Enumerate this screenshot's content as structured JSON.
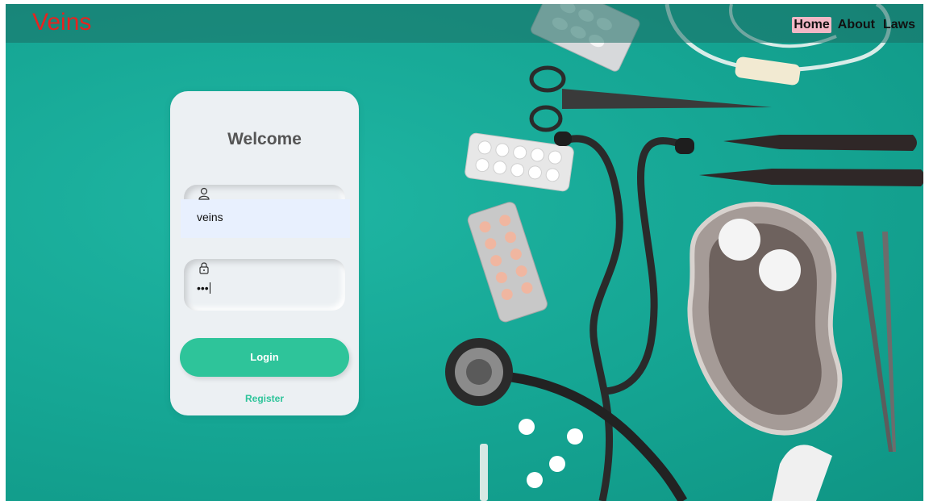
{
  "navbar": {
    "brand": "Veins",
    "links": [
      {
        "label": "Home",
        "active": true
      },
      {
        "label": "About",
        "active": false
      },
      {
        "label": "Laws",
        "active": false
      }
    ]
  },
  "login_card": {
    "heading": "Welcome",
    "username": {
      "icon": "user-icon",
      "value": "veins"
    },
    "password": {
      "icon": "lock-icon",
      "value": "•••"
    },
    "login_label": "Login",
    "register_label": "Register"
  },
  "colors": {
    "background": "#15a593",
    "brand": "#e6231f",
    "accent": "#2ec49a",
    "card": "#ecf0f3",
    "active_link": "#f2b8c6"
  }
}
